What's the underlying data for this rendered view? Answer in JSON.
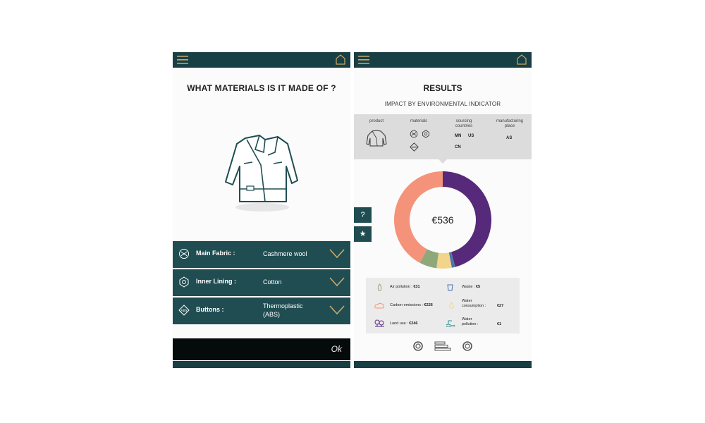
{
  "left": {
    "question": "WHAT MATERIALS IS IT MADE OF ?",
    "materials": [
      {
        "label": "Main Fabric :",
        "value": "Cashmere wool",
        "icon": "main-fabric-icon"
      },
      {
        "label": "Inner Lining :",
        "value": "Cotton",
        "icon": "inner-lining-icon"
      },
      {
        "label": "Buttons :",
        "value_line1": "Thermoplastic",
        "value_line2": "(ABS)",
        "icon": "abs-badge-icon"
      }
    ],
    "ok_label": "Ok"
  },
  "right": {
    "title": "RESULTS",
    "subtitle": "IMPACT BY ENVIRONMENTAL INDICATOR",
    "summary": {
      "product_label": "product",
      "materials_label": "materials",
      "sourcing_label_line1": "sourcing",
      "sourcing_label_line2": "countries",
      "manufacturing_label_line1": "manufacturing",
      "manufacturing_label_line2": "place",
      "sourcing_countries": [
        "MN",
        "US",
        "CN"
      ],
      "manufacturing_place": "AS"
    },
    "total": "€536",
    "help_label": "?",
    "star_label": "★",
    "indicators": [
      {
        "name": "Air pollution",
        "value": "€31",
        "color": "#8fa87a"
      },
      {
        "name": "Waste",
        "value": "€5",
        "color": "#4a6fb0"
      },
      {
        "name": "Carbon emissions",
        "value": "€226",
        "color": "#f4937a"
      },
      {
        "name_line1": "Water",
        "name_line2": "consumption :",
        "value": "€27",
        "color": "#f2d58a"
      },
      {
        "name": "Land use",
        "value": "€246",
        "color": "#56297a"
      },
      {
        "name_line1": "Water",
        "name_line2": "pollution :",
        "value": "€1",
        "color": "#2e8c8c"
      }
    ]
  },
  "chart_data": {
    "type": "pie",
    "center_label": "€536",
    "categories": [
      "Land use",
      "Water pollution",
      "Waste",
      "Water consumption",
      "Air pollution",
      "Carbon emissions"
    ],
    "values": [
      246,
      1,
      5,
      27,
      31,
      226
    ],
    "colors": [
      "#56297a",
      "#2e8c8c",
      "#4a6fb0",
      "#f2d58a",
      "#8fa87a",
      "#f4937a"
    ]
  }
}
